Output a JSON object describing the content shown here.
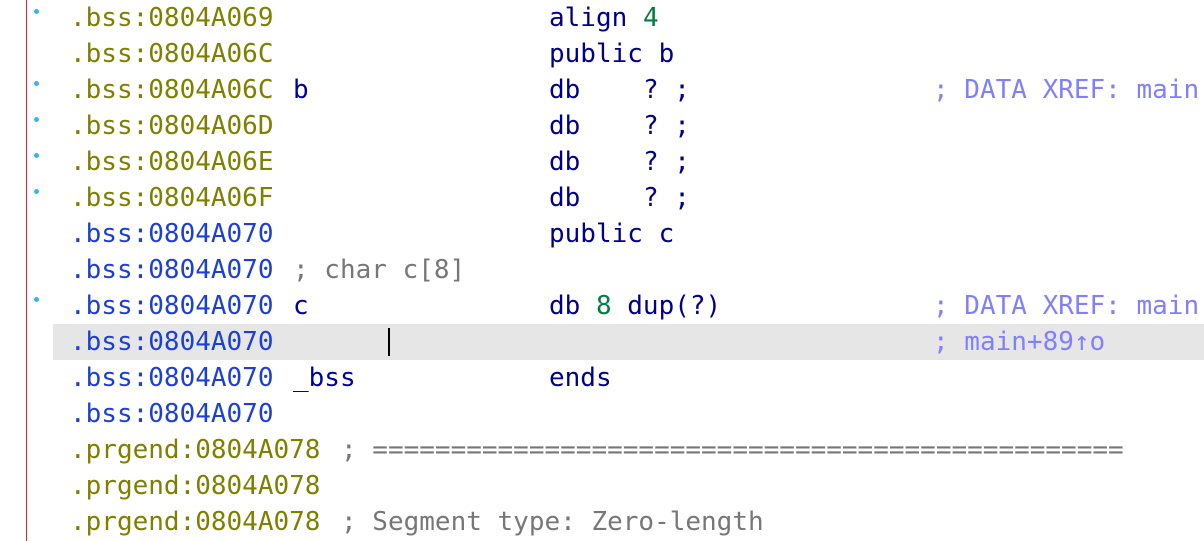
{
  "colors": {
    "address_olive": "#7f8000",
    "address_blue": "#1c3fd6",
    "mnemonic": "#00008b",
    "number": "#008040",
    "xref_comment": "#8080ff",
    "comment_gray": "#777777",
    "gutter_line": "#d62828",
    "bullet": "#3db4e5",
    "current_line_bg": "#e6e6e6"
  },
  "lines": [
    {
      "addr": ".bss:0804A069",
      "label": "",
      "mnemonic": "align",
      "operand": "4",
      "xref": ""
    },
    {
      "addr": ".bss:0804A06C",
      "label": "",
      "mnemonic": "public",
      "operand": "b",
      "xref": ""
    },
    {
      "addr": ".bss:0804A06C",
      "label": "b",
      "mnemonic": "db",
      "operand": "? ;",
      "xref": "; DATA XREF: main"
    },
    {
      "addr": ".bss:0804A06D",
      "label": "",
      "mnemonic": "db",
      "operand": "? ;",
      "xref": ""
    },
    {
      "addr": ".bss:0804A06E",
      "label": "",
      "mnemonic": "db",
      "operand": "? ;",
      "xref": ""
    },
    {
      "addr": ".bss:0804A06F",
      "label": "",
      "mnemonic": "db",
      "operand": "? ;",
      "xref": ""
    },
    {
      "addr": ".bss:0804A070",
      "label": "",
      "mnemonic": "public",
      "operand": "c",
      "xref": ""
    },
    {
      "addr": ".bss:0804A070",
      "comment": "; char c[8]"
    },
    {
      "addr": ".bss:0804A070",
      "label": "c",
      "mnemonic": "db",
      "operand_num": "8",
      "operand_rest": "dup(?)",
      "xref": "; DATA XREF: main"
    },
    {
      "addr": ".bss:0804A070",
      "xref": "; main+89↑o"
    },
    {
      "addr": ".bss:0804A070",
      "label": "_bss",
      "mnemonic": "ends"
    },
    {
      "addr": ".bss:0804A070"
    },
    {
      "addr": ".prgend:0804A078",
      "separator": "; ================================================"
    },
    {
      "addr": ".prgend:0804A078"
    },
    {
      "addr": ".prgend:0804A078",
      "separator": "; Segment type: Zero-length"
    }
  ]
}
